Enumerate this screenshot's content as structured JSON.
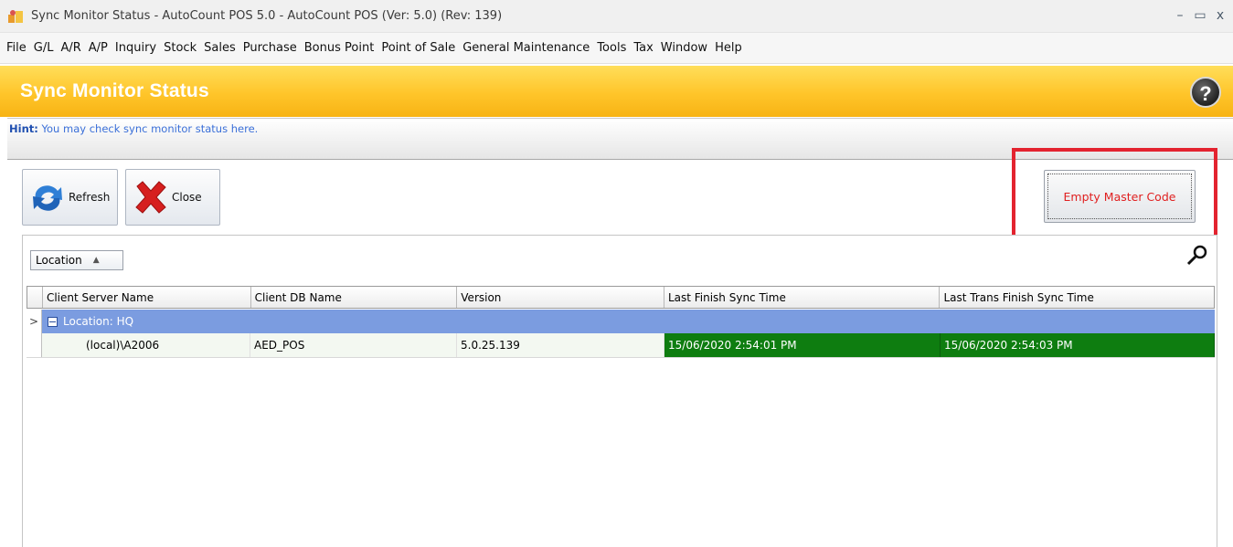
{
  "window": {
    "title": "Sync Monitor Status - AutoCount POS 5.0 - AutoCount POS (Ver: 5.0) (Rev: 139)",
    "minimize": "–",
    "maximize": "▭",
    "close": "x"
  },
  "menu": [
    "File",
    "G/L",
    "A/R",
    "A/P",
    "Inquiry",
    "Stock",
    "Sales",
    "Purchase",
    "Bonus Point",
    "Point of Sale",
    "General Maintenance",
    "Tools",
    "Tax",
    "Window",
    "Help"
  ],
  "header": {
    "title": "Sync Monitor Status",
    "help_glyph": "?"
  },
  "hint": {
    "label": "Hint:",
    "text": " You may check sync monitor status here."
  },
  "toolbar": {
    "refresh_label": "Refresh",
    "close_label": "Close",
    "empty_master_label": "Empty Master Code"
  },
  "grid": {
    "group_by_chip": "Location",
    "columns": [
      "Client Server Name",
      "Client DB Name",
      "Version",
      "Last Finish Sync Time",
      "Last Trans Finish Sync Time"
    ],
    "group_row": {
      "indicator": ">",
      "label": "Location: HQ"
    },
    "rows": [
      {
        "client_server_name": "(local)\\A2006",
        "client_db_name": "AED_POS",
        "version": "5.0.25.139",
        "last_finish_sync_time": "15/06/2020 2:54:01 PM",
        "last_trans_finish_sync_time": "15/06/2020 2:54:03 PM"
      }
    ]
  },
  "colors": {
    "header_gradient_top": "#ffde5a",
    "header_gradient_bottom": "#f7b314",
    "group_row": "#7b9ce0",
    "sync_ok": "#0e7d10",
    "highlight": "#e3232f",
    "hint_text": "#3a6fd8"
  },
  "icons": {
    "app": "autocount-app-icon",
    "refresh": "refresh-arrows-icon",
    "close": "red-x-icon",
    "search": "magnifier-icon",
    "help": "help-icon"
  }
}
